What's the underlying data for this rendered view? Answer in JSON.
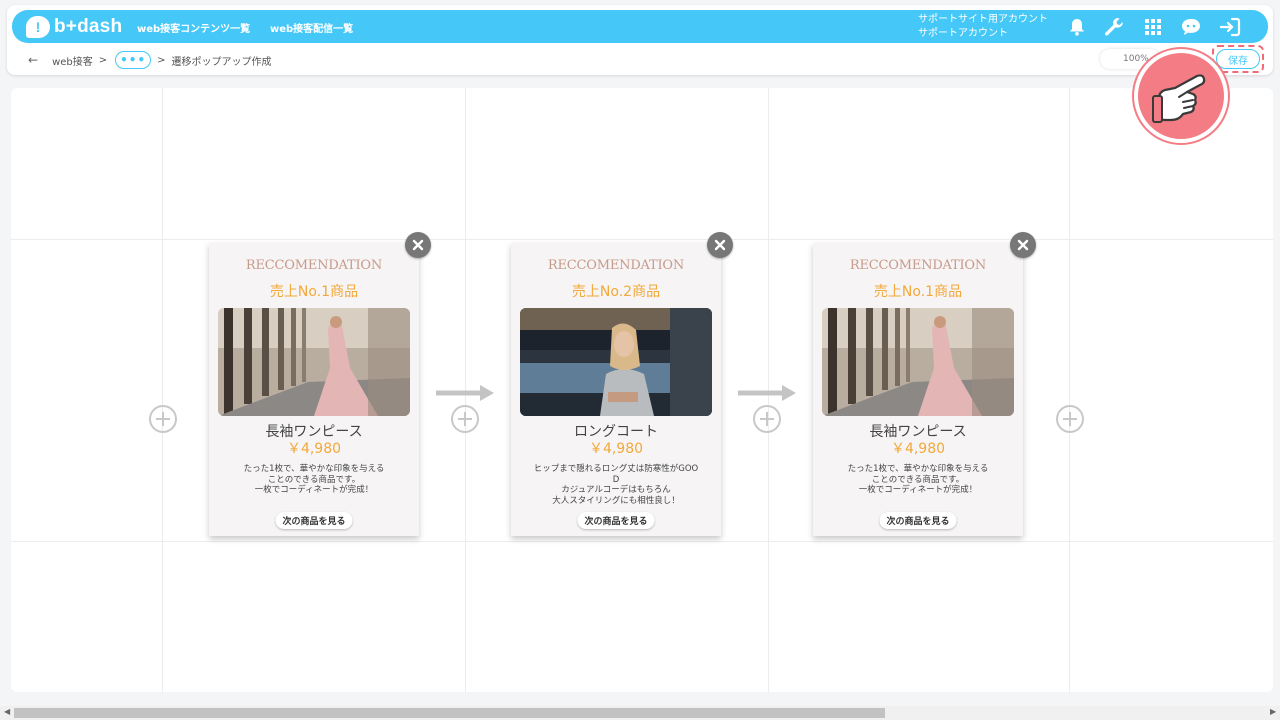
{
  "app": {
    "logo_text": "b+dash",
    "nav": [
      "web接客コンテンツ一覧",
      "web接客配信一覧"
    ],
    "account_line1": "サポートサイト用アカウント",
    "account_line2": "サポートアカウント"
  },
  "breadcrumb": {
    "back_symbol": "←",
    "root": "web接客",
    "more": "•••",
    "current": "遷移ポップアップ作成",
    "separator": ">"
  },
  "toolbar": {
    "zoom": "100%",
    "save_label": "保存"
  },
  "popups": [
    {
      "eyebrow": "RECCOMENDATION",
      "rank": "売上No.1商品",
      "image": "dress-photo",
      "name": "長袖ワンピース",
      "price": "￥4,980",
      "description": "たった1枚で、華やかな印象を与える\nことのできる商品です。\n一枚でコーディネートが完成！",
      "button": "次の商品を見る"
    },
    {
      "eyebrow": "RECCOMENDATION",
      "rank": "売上No.2商品",
      "image": "coat-photo",
      "name": "ロングコート",
      "price": "￥4,980",
      "description": "ヒップまで隠れるロング丈は防寒性がGOO\nD\nカジュアルコーデはもちろん\n大人スタイリングにも相性良し！",
      "button": "次の商品を見る"
    },
    {
      "eyebrow": "RECCOMENDATION",
      "rank": "売上No.1商品",
      "image": "dress-photo",
      "name": "長袖ワンピース",
      "price": "￥4,980",
      "description": "たった1枚で、華やかな印象を与える\nことのできる商品です。\n一枚でコーディネートが完成！",
      "button": "次の商品を見る"
    }
  ],
  "colors": {
    "accent": "#45c8f7",
    "price": "#f2a93b",
    "eyebrow": "#c89a8a",
    "pointer": "#f47c84"
  }
}
